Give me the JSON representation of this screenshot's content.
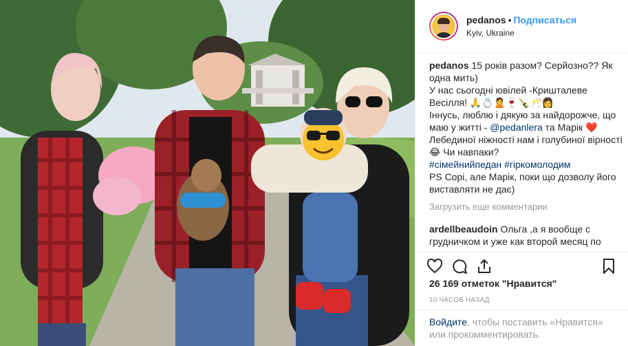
{
  "header": {
    "username": "pedanos",
    "separator": "•",
    "follow_label": "Подписаться",
    "location": "Kyiv, Ukraine"
  },
  "caption": {
    "username": "pedanos",
    "text_part1": "15 років разом? Серйозно?? Як одна мить)",
    "text_part2": "У нас сьогодні ювілей -Кришталеве Весілля! 🙏💍🙎🍷🍾🥂👩",
    "text_part3": "Іннусь, люблю і дякую за найдорожче, що маю у житті - ",
    "mention": "@pedanlera",
    "text_part4": " та Марік ❤️ Лебединої ніжності нам і голубиної вірності 😂 Чи навпаки?",
    "hashtag1": "#сімейнийпедан",
    "hashtag2": "#гіркомолодим",
    "text_part5": "PS Сорі, але Марік, поки що дозволу його виставляти не дає)"
  },
  "load_more_label": "Загрузить еще комментарии",
  "comment": {
    "username": "ardellbeaudoin",
    "text": "Ольга ,а я вообще с грудничком и уже как второй месяц по"
  },
  "actions": {
    "like_icon": "heart-outline-icon",
    "comment_icon": "speech-bubble-icon",
    "share_icon": "share-arrow-icon",
    "save_icon": "bookmark-icon"
  },
  "likes_label": "26 169 отметок \"Нравится\"",
  "timestamp": "10 часов назад",
  "login_prompt": {
    "link": "Войдите",
    "text": ", чтобы поставить «Нравится» или прокомментировать."
  },
  "colors": {
    "link_blue": "#3897f0",
    "tag_blue": "#003569",
    "muted": "#999999",
    "text": "#262626",
    "border": "#efefef"
  }
}
